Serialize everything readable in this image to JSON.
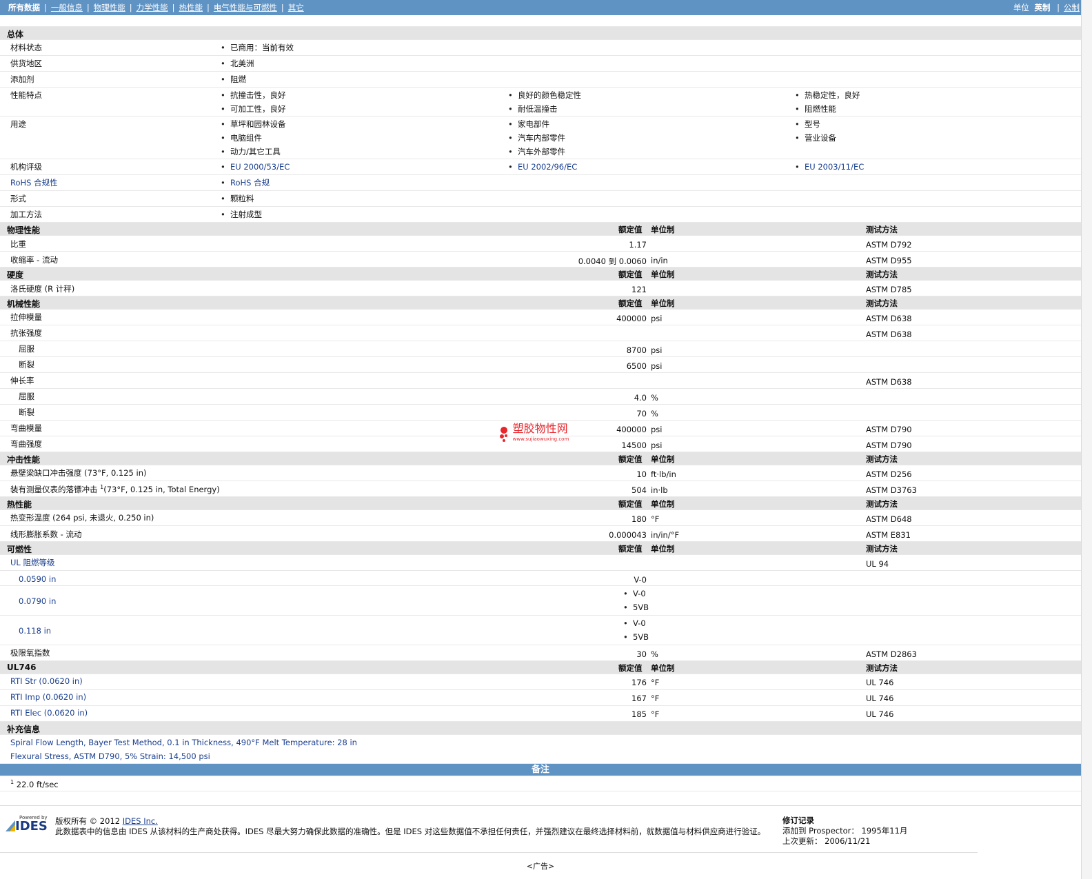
{
  "nav": {
    "tabs": [
      "所有数据",
      "一般信息",
      "物理性能",
      "力学性能",
      "热性能",
      "电气性能与可燃性",
      "其它"
    ],
    "units_label": "单位",
    "unit_current": "英制",
    "unit_other": "公制"
  },
  "general": {
    "title": "总体",
    "status": {
      "label": "材料状态",
      "items": [
        "已商用：当前有效"
      ]
    },
    "region": {
      "label": "供货地区",
      "items": [
        "北美洲"
      ]
    },
    "additive": {
      "label": "添加剂",
      "items": [
        "阻燃"
      ]
    },
    "features": {
      "label": "性能特点",
      "items": [
        "抗撞击性，良好",
        "可加工性，良好",
        "良好的颜色稳定性",
        "耐低温撞击",
        "热稳定性，良好",
        "阻燃性能"
      ]
    },
    "uses": {
      "label": "用途",
      "items": [
        "草坪和园林设备",
        "电脑组件",
        "动力/其它工具",
        "家电部件",
        "汽车内部零件",
        "汽车外部零件",
        "型号",
        "营业设备"
      ]
    },
    "agency": {
      "label": "机构评级",
      "items": [
        "EU 2000/53/EC",
        "EU 2002/96/EC",
        "EU 2003/11/EC"
      ]
    },
    "rohs": {
      "label": "RoHS 合规性",
      "items": [
        "RoHS 合规"
      ]
    },
    "form": {
      "label": "形式",
      "items": [
        "颗粒料"
      ]
    },
    "processing": {
      "label": "加工方法",
      "items": [
        "注射成型"
      ]
    }
  },
  "headers": {
    "nominal": "额定值",
    "unit": "单位制",
    "method": "测试方法"
  },
  "physical": {
    "title": "物理性能",
    "sg": {
      "label": "比重",
      "value": "1.17",
      "unit": "",
      "method": "ASTM D792"
    },
    "shrink": {
      "label": "收缩率 - 流动",
      "value": "0.0040 到 0.0060",
      "unit": "in/in",
      "method": "ASTM D955"
    }
  },
  "hardness": {
    "title": "硬度",
    "rockwell": {
      "label": "洛氏硬度 (R 计秤)",
      "value": "121",
      "unit": "",
      "method": "ASTM D785"
    }
  },
  "mechanical": {
    "title": "机械性能",
    "tmod": {
      "label": "拉伸模量",
      "value": "400000",
      "unit": "psi",
      "method": "ASTM D638"
    },
    "tstr": {
      "label": "抗张强度",
      "method": "ASTM D638"
    },
    "tstr_yield": {
      "label": "屈服",
      "value": "8700",
      "unit": "psi"
    },
    "tstr_break": {
      "label": "断裂",
      "value": "6500",
      "unit": "psi"
    },
    "elong": {
      "label": "伸长率",
      "method": "ASTM D638"
    },
    "elong_yield": {
      "label": "屈服",
      "value": "4.0",
      "unit": "%"
    },
    "elong_break": {
      "label": "断裂",
      "value": "70",
      "unit": "%"
    },
    "fmod": {
      "label": "弯曲模量",
      "value": "400000",
      "unit": "psi",
      "method": "ASTM D790"
    },
    "fstr": {
      "label": "弯曲强度",
      "value": "14500",
      "unit": "psi",
      "method": "ASTM D790"
    }
  },
  "impact": {
    "title": "冲击性能",
    "izod": {
      "label": "悬壁梁缺口冲击强度 (73°F, 0.125 in)",
      "value": "10",
      "unit": "ft·lb/in",
      "method": "ASTM D256"
    },
    "dart": {
      "label": "装有测量仪表的落镖冲击",
      "sup": "1",
      "label_tail": "(73°F, 0.125 in, Total Energy)",
      "value": "504",
      "unit": "in·lb",
      "method": "ASTM D3763"
    }
  },
  "thermal": {
    "title": "热性能",
    "hdt": {
      "label": "热变形温度 (264 psi, 未退火, 0.250 in)",
      "value": "180",
      "unit": "°F",
      "method": "ASTM D648"
    },
    "clte": {
      "label": "线形膨胀系数 - 流动",
      "value": "0.000043",
      "unit": "in/in/°F",
      "method": "ASTM E831"
    }
  },
  "flammability": {
    "title": "可燃性",
    "ul": {
      "label": "UL 阻燃等级",
      "method": "UL 94"
    },
    "t1": {
      "label": "0.0590 in",
      "value": "V-0"
    },
    "t2": {
      "label": "0.0790 in",
      "items": [
        "V-0",
        "5VB"
      ]
    },
    "t3": {
      "label": "0.118 in",
      "items": [
        "V-0",
        "5VB"
      ]
    },
    "loi": {
      "label": "极限氧指数",
      "value": "30",
      "unit": "%",
      "method": "ASTM D2863"
    }
  },
  "ul746": {
    "title": "UL746",
    "str": {
      "label": "RTI Str (0.0620 in)",
      "value": "176",
      "unit": "°F",
      "method": "UL 746"
    },
    "imp": {
      "label": "RTI Imp (0.0620 in)",
      "value": "167",
      "unit": "°F",
      "method": "UL 746"
    },
    "elec": {
      "label": "RTI Elec (0.0620 in)",
      "value": "185",
      "unit": "°F",
      "method": "UL 746"
    }
  },
  "supplemental": {
    "title": "补充信息",
    "lines": [
      "Spiral Flow Length, Bayer Test Method, 0.1 in Thickness, 490°F Melt Temperature: 28 in",
      "Flexural Stress, ASTM D790, 5% Strain: 14,500 psi"
    ]
  },
  "notes": {
    "title": "备注",
    "sup": "1",
    "text": "22.0 ft/sec"
  },
  "footer": {
    "logo_top": "Powered by",
    "logo_text": "IDES",
    "copyright_pre": "版权所有 © 2012",
    "copyright_link": "IDES Inc.",
    "disclaimer": "此数据表中的信息由 IDES 从该材料的生产商处获得。IDES 尽最大努力确保此数据的准确性。但是 IDES 对这些数据值不承担任何责任，并强烈建议在最终选择材料前，就数据值与材料供应商进行验证。",
    "rev_title": "修订记录",
    "added_label": "添加到 Prospector：",
    "added_value": "1995年11月",
    "updated_label": "上次更新：",
    "updated_value": "2006/11/21"
  },
  "ad": "<广告>",
  "watermark": {
    "text": "塑胶物性网",
    "url": "www.sujiaowuxing.com"
  }
}
